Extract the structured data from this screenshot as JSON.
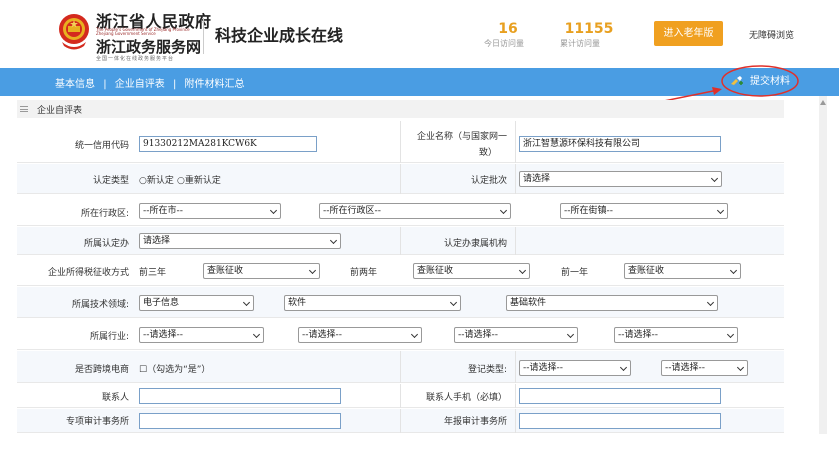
{
  "header": {
    "brand_line1": "浙江省人民政府",
    "brand_en_line1": "The People's Government of Zhejiang Province",
    "brand_en_line2": "Zhejiang Government Service",
    "brand_line2": "浙江政务服务网",
    "brand_sub": "全国一体化在线政务服务平台",
    "site_title": "科技企业成长在线",
    "stats": [
      {
        "value": "16",
        "label": "今日访问量"
      },
      {
        "value": "11155",
        "label": "累计访问量"
      }
    ],
    "elder_button": "进入老年版",
    "accessibility": "无障碍浏览"
  },
  "nav": {
    "links": [
      "基本信息",
      "企业自评表",
      "附件材料汇总"
    ],
    "separator": "|",
    "submit": "提交材料"
  },
  "section": {
    "title": "企业自评表"
  },
  "form": {
    "credit_code_label": "统一信用代码",
    "credit_code_value": "91330212MA281KCW6K",
    "company_name_label_1": "企业名称（与国家网一",
    "company_name_label_2": "致）",
    "company_name_value": "浙江智慧源环保科技有限公司",
    "cert_type_label": "认定类型",
    "cert_type_new": "○新认定",
    "cert_type_renew": "○重新认定",
    "cert_batch_label": "认定批次",
    "cert_batch_value": "请选择",
    "region_label": "所在行政区:",
    "region_city": "--所在市--",
    "region_district": "--所在行政区--",
    "region_street": "--所在街镇--",
    "office_label": "所属认定办",
    "office_value": "请选择",
    "office_org_label": "认定办隶属机构",
    "tax_label": "企业所得税征收方式",
    "tax_y3_label": "前三年",
    "tax_y3_value": "查账征收",
    "tax_y2_label": "前两年",
    "tax_y2_value": "查账征收",
    "tax_y1_label": "前一年",
    "tax_y1_value": "查账征收",
    "tech_label": "所属技术领域:",
    "tech_1": "电子信息",
    "tech_2": "软件",
    "tech_3": "基础软件",
    "industry_label": "所属行业:",
    "industry_1": "--请选择--",
    "industry_2": "--请选择--",
    "industry_3": "--请选择--",
    "industry_4": "--请选择--",
    "ecommerce_label": "是否跨境电商",
    "ecommerce_check": "☐（勾选为“是”）",
    "reg_type_label": "登记类型:",
    "reg_type_1": "--请选择--",
    "reg_type_2": "--请选择--",
    "contact_label": "联系人",
    "contact_phone_label": "联系人手机（必填）",
    "audit_special_label": "专项审计事务所",
    "audit_annual_label": "年报审计事务所"
  },
  "colors": {
    "nav_bg": "#4a9de3",
    "accent_orange": "#f0a020",
    "annotation_red": "#e0302a"
  }
}
